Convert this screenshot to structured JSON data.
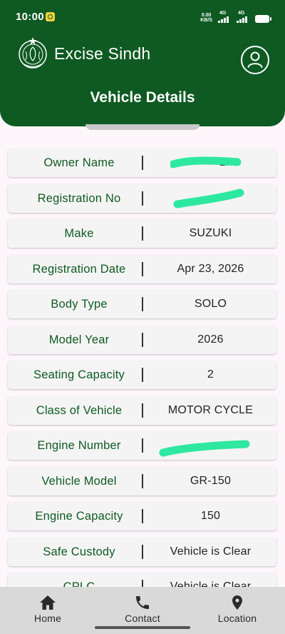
{
  "status_bar": {
    "time": "10:00",
    "net_speed_top": "0.00",
    "net_speed_bottom": "KB/S",
    "signal1": "4G",
    "signal2": "4G"
  },
  "header": {
    "app_title": "Excise Sindh",
    "page_title": "Vehicle Details"
  },
  "colors": {
    "brand_green": "#0e5a22",
    "redaction": "#2ee8a0",
    "nav_bg": "#d9d9d9"
  },
  "details": [
    {
      "label": "Owner Name",
      "value": "LI",
      "redacted": true
    },
    {
      "label": "Registration No",
      "value": "",
      "redacted": true
    },
    {
      "label": "Make",
      "value": "SUZUKI",
      "redacted": false
    },
    {
      "label": "Registration Date",
      "value": "Apr 23, 2026",
      "redacted": false
    },
    {
      "label": "Body Type",
      "value": "SOLO",
      "redacted": false
    },
    {
      "label": "Model Year",
      "value": "2026",
      "redacted": false
    },
    {
      "label": "Seating Capacity",
      "value": "2",
      "redacted": false
    },
    {
      "label": "Class of Vehicle",
      "value": "MOTOR CYCLE",
      "redacted": false
    },
    {
      "label": "Engine Number",
      "value": "",
      "redacted": true
    },
    {
      "label": "Vehicle Model",
      "value": "GR-150",
      "redacted": false
    },
    {
      "label": "Engine Capacity",
      "value": "150",
      "redacted": false
    },
    {
      "label": "Safe Custody",
      "value": "Vehicle is Clear",
      "redacted": false
    },
    {
      "label": "CPLC",
      "value": "Vehicle is Clear",
      "redacted": false
    }
  ],
  "nav": {
    "home": "Home",
    "contact": "Contact",
    "location": "Location"
  }
}
